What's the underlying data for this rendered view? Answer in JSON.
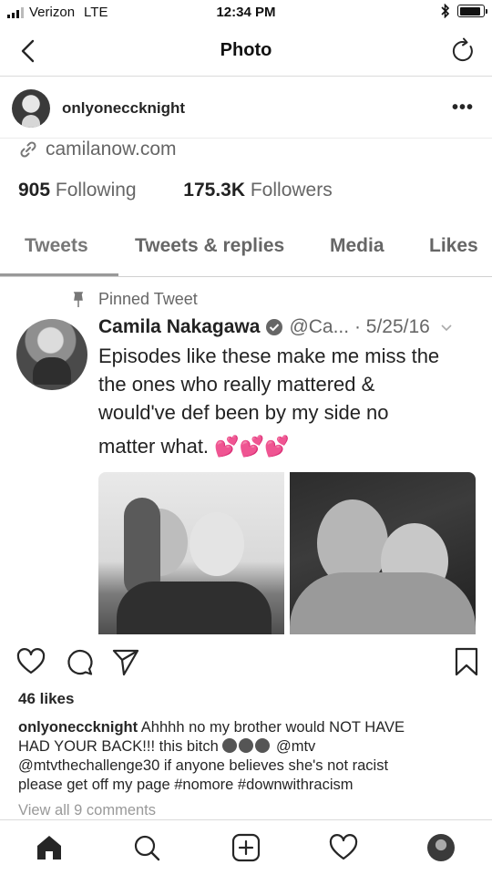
{
  "status_bar": {
    "carrier": "Verizon",
    "network": "LTE",
    "time": "12:34 PM",
    "battery_level": 0.9
  },
  "nav": {
    "title": "Photo",
    "back_icon": "chevron-left-icon",
    "refresh_icon": "refresh-icon"
  },
  "post": {
    "username": "onlyoneccknight",
    "more_label": "•••"
  },
  "screenshot": {
    "link": "camilanow.com",
    "following_count": "905",
    "following_label": "Following",
    "followers_count": "175.3K",
    "followers_label": "Followers",
    "tabs": [
      "Tweets",
      "Tweets & replies",
      "Media",
      "Likes"
    ],
    "active_tab": "Tweets",
    "pinned_label": "Pinned Tweet",
    "tweet": {
      "name": "Camila Nakagawa",
      "handle_date": "@Ca... · 5/25/16",
      "text_lines": [
        "Episodes like these make me miss the",
        "the ones who really mattered &",
        "would've def been by my side no",
        "matter what. 💕💕💕"
      ]
    }
  },
  "actions": {
    "like_icon": "heart-icon",
    "comment_icon": "comment-icon",
    "share_icon": "send-icon",
    "save_icon": "bookmark-icon"
  },
  "likes": "46 likes",
  "caption": {
    "username": "onlyoneccknight",
    "line1": " Ahhhh no my brother would NOT HAVE",
    "line2a": "HAD YOUR BACK!!! this bitch ",
    "line2b": " @mtv",
    "line3": "@mtvthechallenge30 if anyone believes she's not racist",
    "line4": "please get off my page #nomore #downwithracism"
  },
  "view_comments": "View all 9 comments",
  "tab_bar": {
    "items": [
      "home-icon",
      "search-icon",
      "new-post-icon",
      "activity-icon",
      "profile-icon"
    ]
  }
}
